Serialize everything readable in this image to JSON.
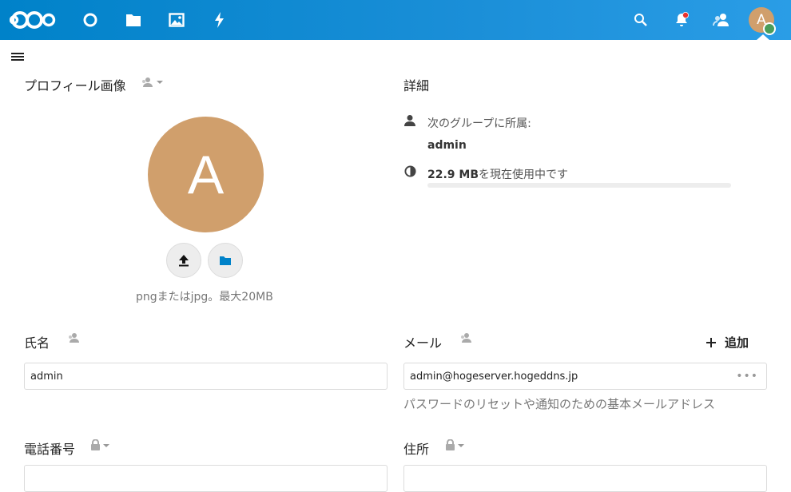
{
  "header": {
    "icons": [
      "nextcloud-logo",
      "dashboard-icon",
      "files-icon",
      "photos-icon",
      "activity-icon",
      "search-icon",
      "notifications-icon",
      "contacts-icon"
    ],
    "avatar_initial": "A",
    "accent_color": "#0082c9",
    "avatar_color": "#d09f6c",
    "status_color": "#4a9d5a"
  },
  "profile_picture": {
    "title": "プロフィール画像",
    "avatar_initial": "A",
    "hint": "pngまたはjpg。最大20MB",
    "upload_icon": "upload-icon",
    "folder_icon": "folder-icon"
  },
  "details": {
    "title": "詳細",
    "groups_label": "次のグループに所属:",
    "group_name": "admin",
    "quota_value": "22.9 MB",
    "quota_suffix": "を現在使用中です",
    "quota_fraction": 0.0
  },
  "fullname": {
    "label": "氏名",
    "value": "admin"
  },
  "email": {
    "label": "メール",
    "add_label": "追加",
    "value": "admin@hogeserver.hogeddns.jp",
    "help": "パスワードのリセットや通知のための基本メールアドレス",
    "more_label": "•••"
  },
  "phone": {
    "label": "電話番号"
  },
  "address": {
    "label": "住所"
  }
}
